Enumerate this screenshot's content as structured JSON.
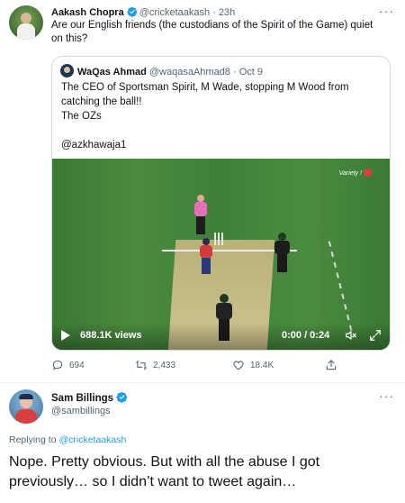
{
  "tweet": {
    "author_name": "Aakash Chopra",
    "author_handle": "@cricketaakash",
    "separator": "·",
    "time": "23h",
    "text": "Are our English friends (the custodians of the Spirit of the Game) quiet on this?",
    "quote": {
      "author_name": "WaQas Ahmad",
      "author_handle": "@waqasaAhmad8",
      "separator": "·",
      "time": "Oct 9",
      "text": "The CEO of Sportsman Spirit, M Wade, stopping M Wood from catching the ball!!\nThe OZs\n\n@azkhawaja1",
      "video": {
        "views": "688.1K views",
        "time": "0:00 / 0:24",
        "broadcaster_label": "Variety !"
      }
    },
    "actions": {
      "replies": "694",
      "retweets": "2,433",
      "likes": "18.4K"
    }
  },
  "reply": {
    "author_name": "Sam Billings",
    "author_handle": "@sambillings",
    "replying_prefix": "Replying to",
    "replying_to": "@cricketaakash",
    "text": "Nope. Pretty obvious. But with all the abuse I got previously… so I didn’t want to tweet again…"
  },
  "colors": {
    "accent": "#1d9bf0",
    "text": "#0f1419",
    "muted": "#536471",
    "border": "#cfd9de"
  },
  "icons": [
    "verified-icon",
    "more-icon",
    "play-icon",
    "volume-muted-icon",
    "fullscreen-icon",
    "reply-icon",
    "retweet-icon",
    "like-icon",
    "share-icon"
  ]
}
